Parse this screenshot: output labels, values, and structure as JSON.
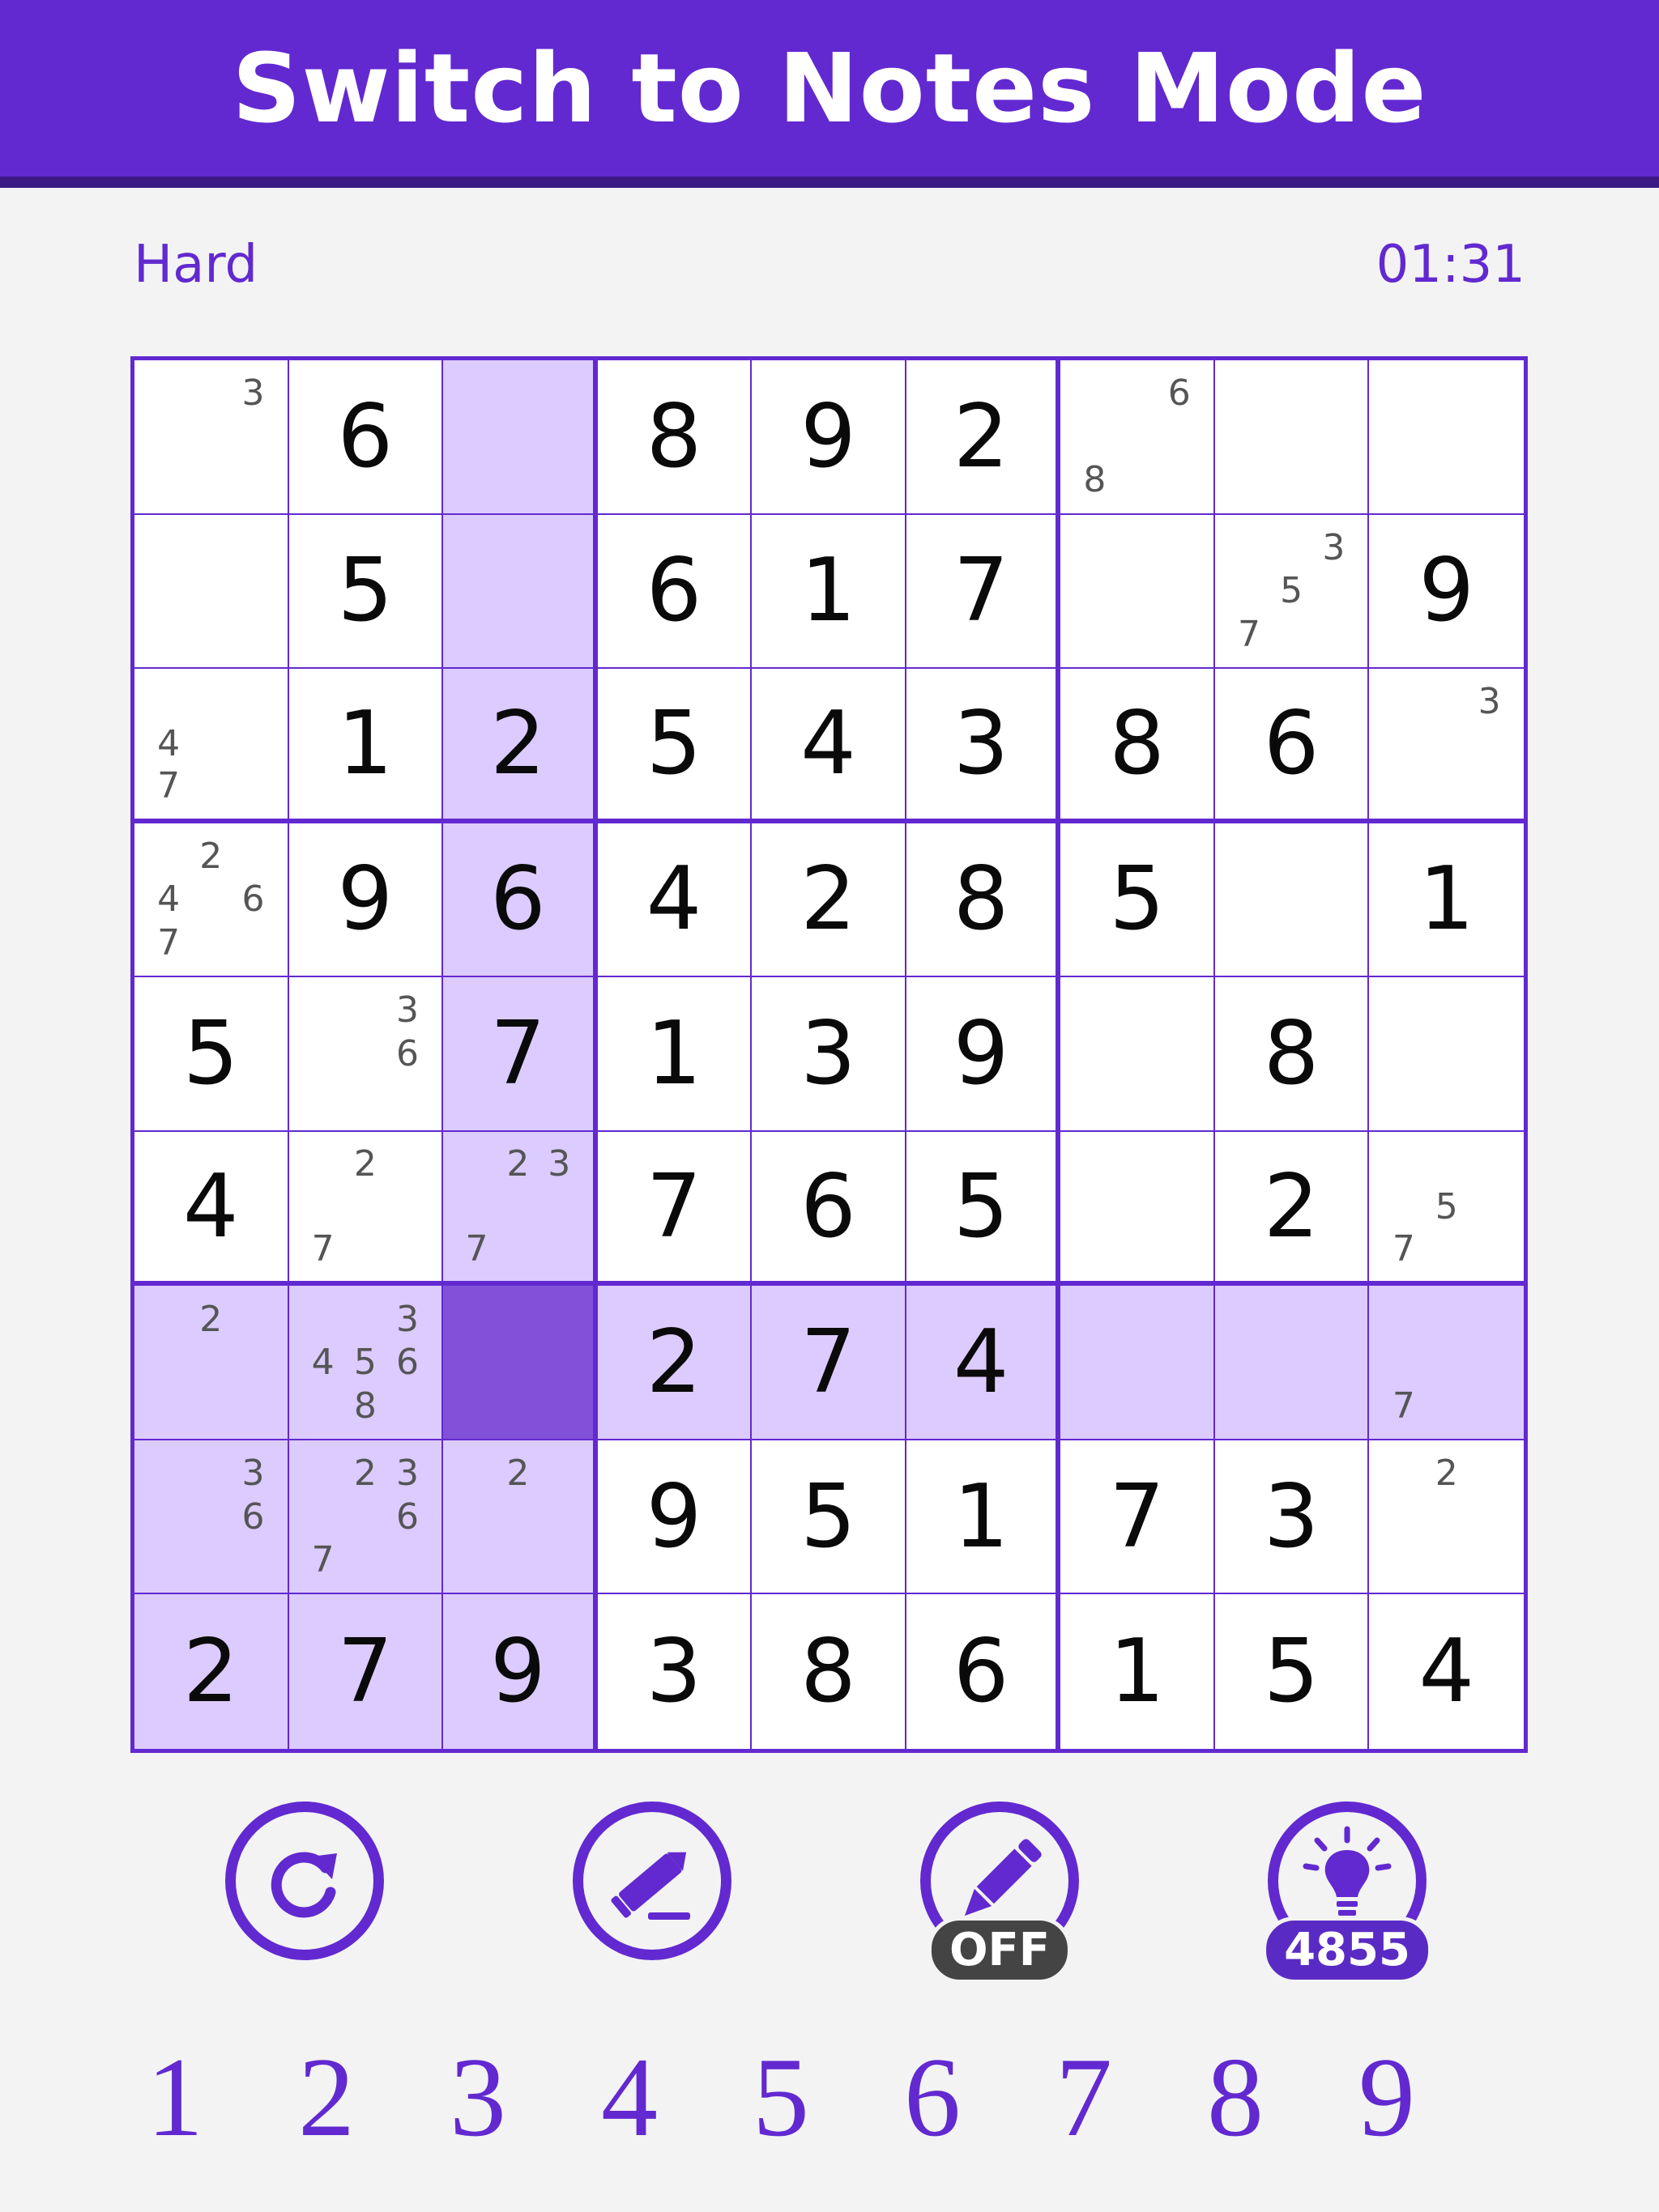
{
  "header": {
    "title": "Switch to Notes Mode"
  },
  "status": {
    "difficulty": "Hard",
    "timer": "01:31"
  },
  "board": {
    "selected": [
      6,
      2
    ],
    "highlight_rows": [
      6
    ],
    "highlight_cols": [
      2
    ],
    "highlight_box": [
      2,
      0
    ],
    "cells": [
      [
        {
          "notes": {
            "3": "3"
          }
        },
        {
          "value": "6"
        },
        {},
        {
          "value": "8"
        },
        {
          "value": "9"
        },
        {
          "value": "2"
        },
        {
          "notes": {
            "3": "6",
            "7": "8"
          }
        },
        {},
        {}
      ],
      [
        {},
        {
          "value": "5"
        },
        {},
        {
          "value": "6"
        },
        {
          "value": "1"
        },
        {
          "value": "7"
        },
        {},
        {
          "notes": {
            "3": "3",
            "5": "5",
            "7": "7"
          }
        },
        {
          "value": "9"
        }
      ],
      [
        {
          "notes": {
            "4": "4",
            "7": "7"
          }
        },
        {
          "value": "1"
        },
        {
          "value": "2"
        },
        {
          "value": "5"
        },
        {
          "value": "4"
        },
        {
          "value": "3"
        },
        {
          "value": "8"
        },
        {
          "value": "6"
        },
        {
          "notes": {
            "3": "3"
          }
        }
      ],
      [
        {
          "notes": {
            "2": "2",
            "4": "4",
            "6": "6",
            "7": "7"
          }
        },
        {
          "value": "9"
        },
        {
          "value": "6"
        },
        {
          "value": "4"
        },
        {
          "value": "2"
        },
        {
          "value": "8"
        },
        {
          "value": "5"
        },
        {},
        {
          "value": "1"
        }
      ],
      [
        {
          "value": "5"
        },
        {
          "notes": {
            "3": "3",
            "6": "6"
          }
        },
        {
          "value": "7"
        },
        {
          "value": "1"
        },
        {
          "value": "3"
        },
        {
          "value": "9"
        },
        {},
        {
          "value": "8"
        },
        {}
      ],
      [
        {
          "value": "4"
        },
        {
          "notes": {
            "2": "2",
            "7": "7"
          }
        },
        {
          "notes": {
            "2": "2",
            "3": "3",
            "7": "7"
          }
        },
        {
          "value": "7"
        },
        {
          "value": "6"
        },
        {
          "value": "5"
        },
        {},
        {
          "value": "2"
        },
        {
          "notes": {
            "5": "5",
            "7": "7"
          }
        }
      ],
      [
        {
          "notes": {
            "2": "2"
          }
        },
        {
          "notes": {
            "3": "3",
            "4": "4",
            "5": "5",
            "6": "6",
            "8": "8"
          }
        },
        {},
        {
          "value": "2"
        },
        {
          "value": "7"
        },
        {
          "value": "4"
        },
        {},
        {},
        {
          "notes": {
            "7": "7"
          }
        }
      ],
      [
        {
          "notes": {
            "3": "3",
            "6": "6"
          }
        },
        {
          "notes": {
            "2": "2",
            "3": "3",
            "6": "6",
            "7": "7"
          }
        },
        {
          "notes": {
            "2": "2"
          }
        },
        {
          "value": "9"
        },
        {
          "value": "5"
        },
        {
          "value": "1"
        },
        {
          "value": "7"
        },
        {
          "value": "3"
        },
        {
          "notes": {
            "2": "2"
          }
        }
      ],
      [
        {
          "value": "2"
        },
        {
          "value": "7"
        },
        {
          "value": "9"
        },
        {
          "value": "3"
        },
        {
          "value": "8"
        },
        {
          "value": "6"
        },
        {
          "value": "1"
        },
        {
          "value": "5"
        },
        {
          "value": "4"
        }
      ]
    ]
  },
  "tools": {
    "undo": {
      "icon": "undo-icon"
    },
    "erase": {
      "icon": "eraser-icon"
    },
    "notes": {
      "icon": "pencil-icon",
      "badge": "OFF"
    },
    "hint": {
      "icon": "lightbulb-icon",
      "badge": "4855"
    }
  },
  "numpad": [
    "1",
    "2",
    "3",
    "4",
    "5",
    "6",
    "7",
    "8",
    "9"
  ],
  "colors": {
    "accent": "#6229d0",
    "highlight": "#dccbff",
    "selected": "#8152d9",
    "background": "#f3f3f3"
  }
}
